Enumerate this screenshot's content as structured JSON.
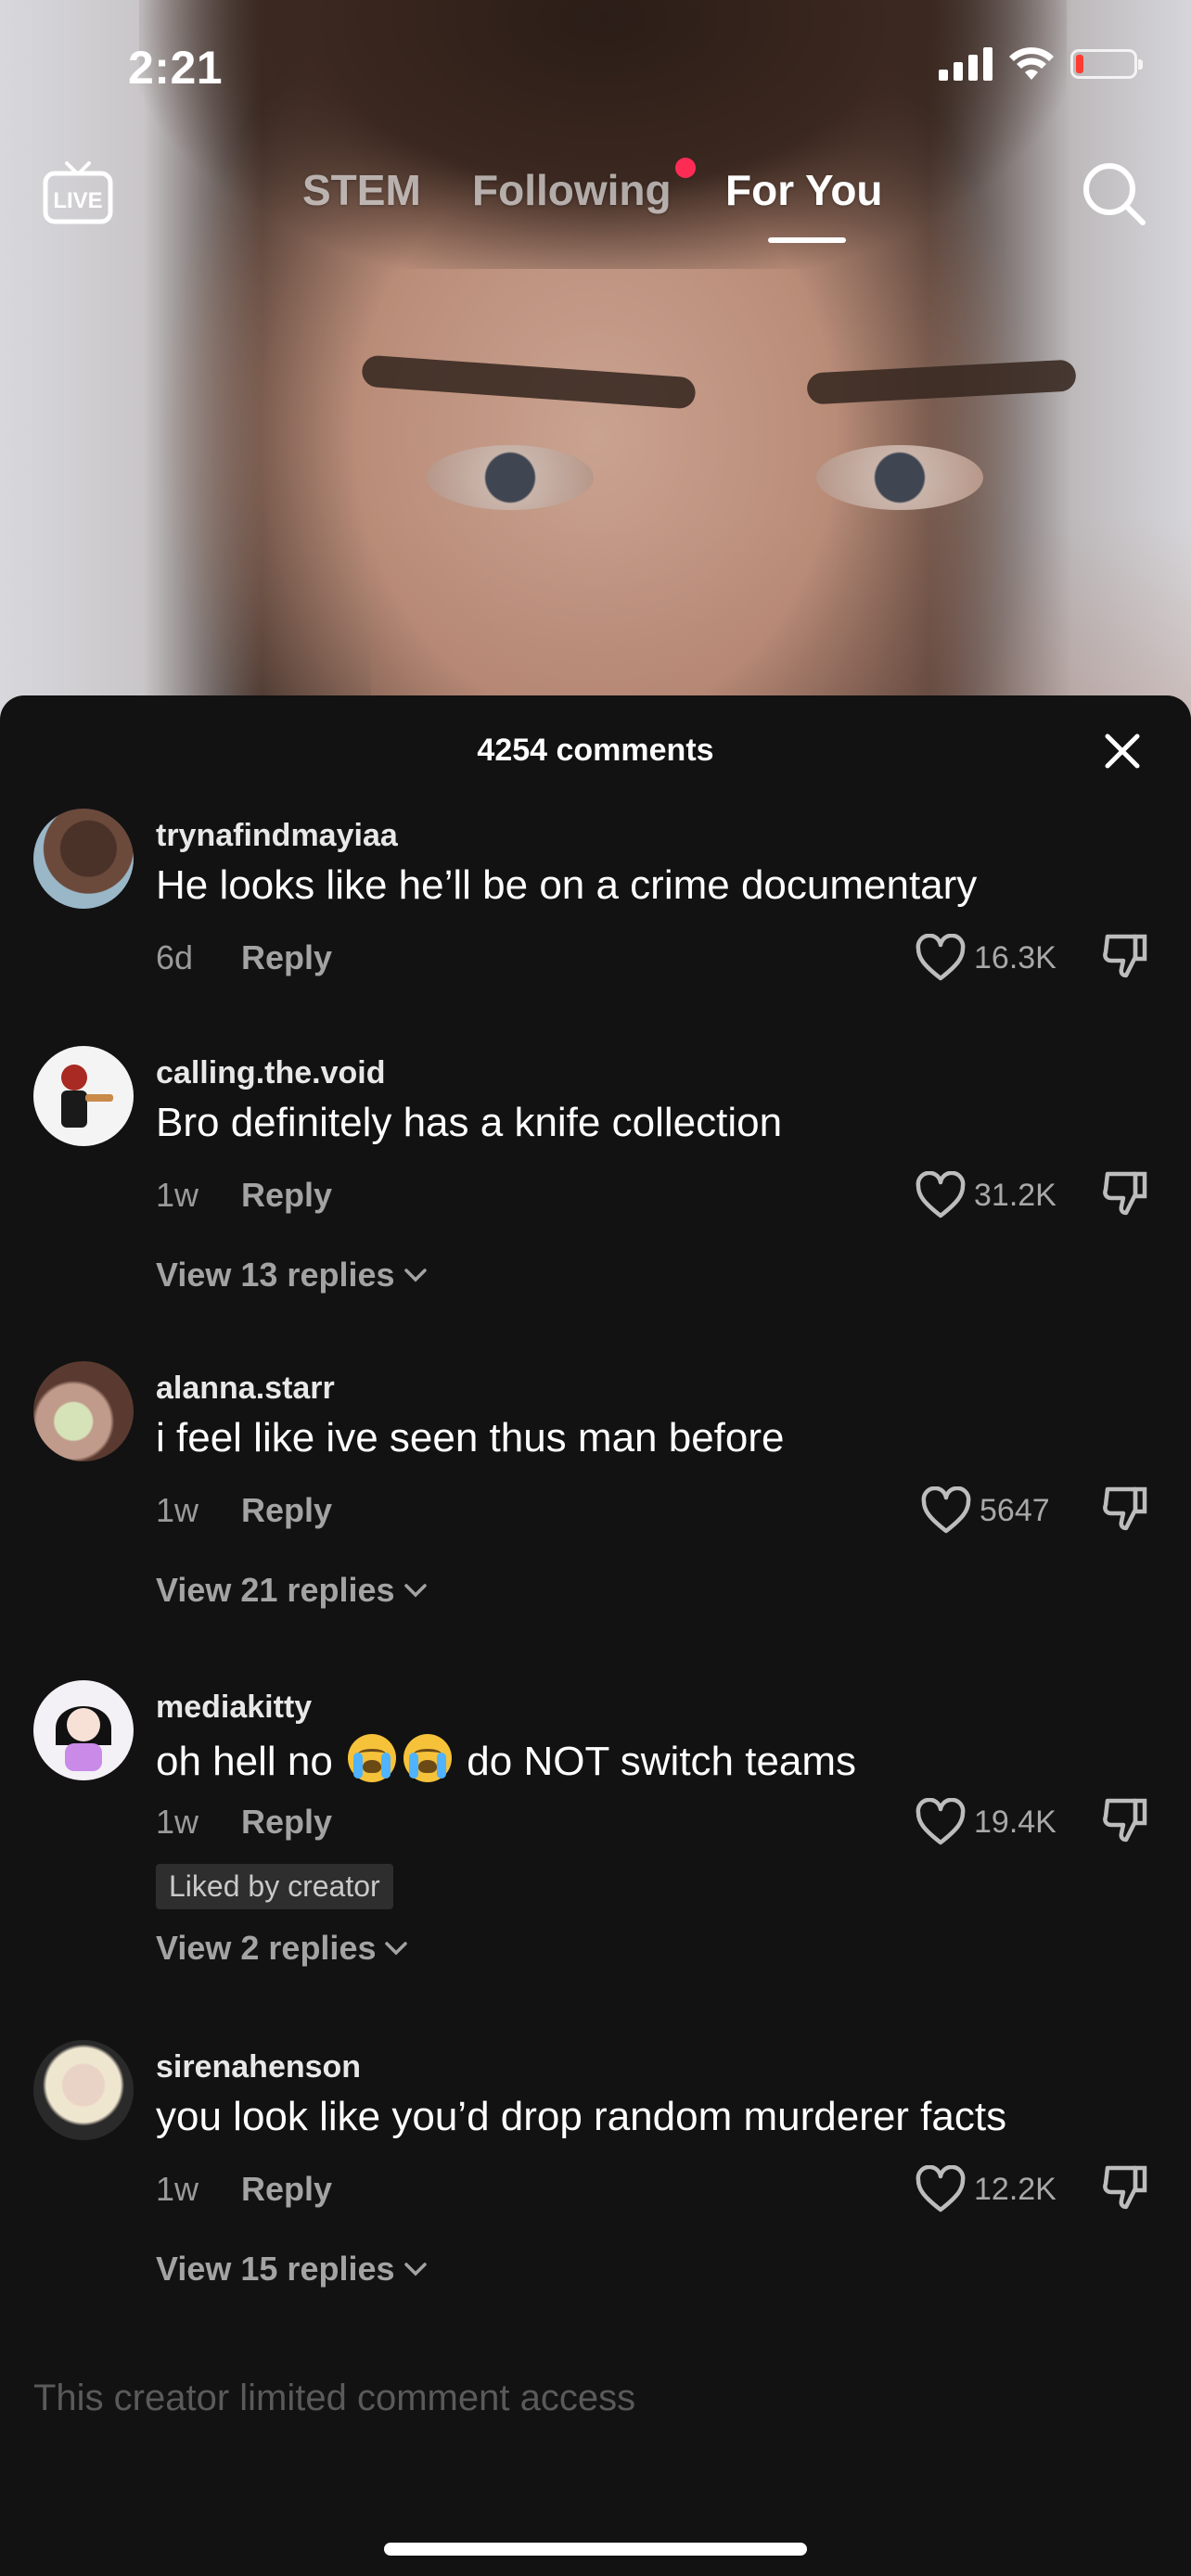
{
  "status_bar": {
    "time": "2:21"
  },
  "top_nav": {
    "live_label": "LIVE",
    "tabs": [
      {
        "label": "STEM",
        "active": false
      },
      {
        "label": "Following",
        "active": false,
        "has_dot": true
      },
      {
        "label": "For You",
        "active": true
      }
    ]
  },
  "comments_sheet": {
    "title": "4254 comments",
    "comments": [
      {
        "username": "trynafindmayiaa",
        "text": "He looks like he’ll be on a crime documentary",
        "time": "6d",
        "reply_label": "Reply",
        "likes": "16.3K"
      },
      {
        "username": "calling.the.void",
        "text": "Bro definitely has a knife collection",
        "time": "1w",
        "reply_label": "Reply",
        "likes": "31.2K",
        "view_replies": "View 13 replies"
      },
      {
        "username": "alanna.starr",
        "text": "i feel like ive seen thus man before",
        "time": "1w",
        "reply_label": "Reply",
        "likes": "5647",
        "view_replies": "View 21 replies"
      },
      {
        "username": "mediakitty",
        "text_before": "oh hell no",
        "text_after": "do NOT switch teams",
        "emoji": "loudly-crying-face x2",
        "time": "1w",
        "reply_label": "Reply",
        "likes": "19.4K",
        "badge": "Liked by creator",
        "view_replies": "View 2 replies"
      },
      {
        "username": "sirenahenson",
        "text": "you look like you’d drop random murderer facts",
        "time": "1w",
        "reply_label": "Reply",
        "likes": "12.2K",
        "view_replies": "View 15 replies"
      }
    ],
    "footer_notice": "This creator limited comment access"
  },
  "colors": {
    "accent_dot": "#fe2c55",
    "sheet_bg": "#121212",
    "battery_low": "#ff3b30"
  }
}
